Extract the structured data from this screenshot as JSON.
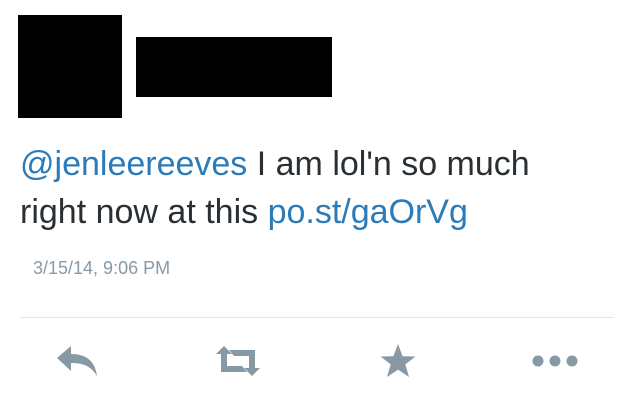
{
  "tweet": {
    "mention": "@jenleereeves",
    "text_line1": " I am lol'n so much",
    "text_line2": "right now at this ",
    "link": "po.st/gaOrVg",
    "timestamp": "3/15/14, 9:06 PM"
  },
  "actions": {
    "reply_icon": "reply-icon",
    "retweet_icon": "retweet-icon",
    "favorite_icon": "star-icon",
    "more_icon": "more-icon"
  },
  "colors": {
    "text": "#292f33",
    "link": "#2b7bb9",
    "muted": "#8899a6",
    "icon": "#8899a6",
    "divider": "#e1e8ed"
  }
}
